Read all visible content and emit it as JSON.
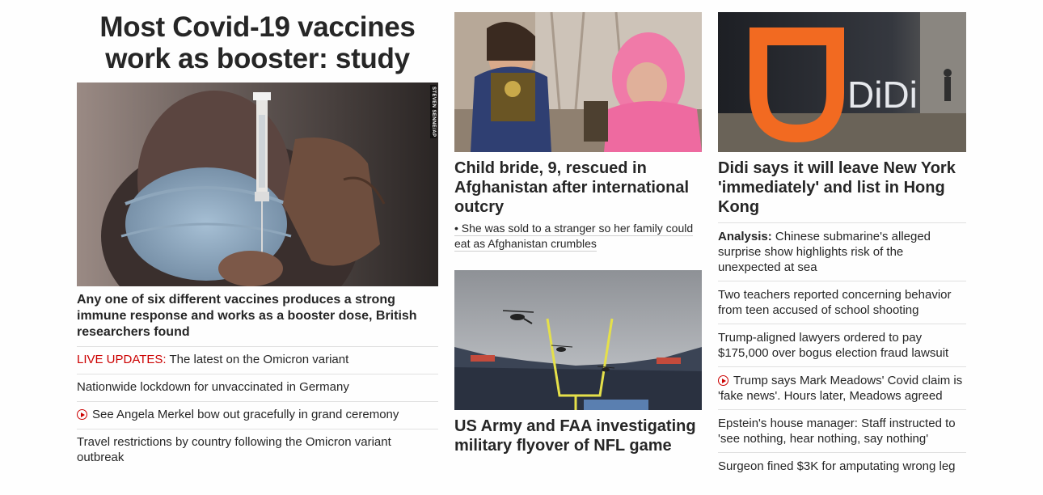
{
  "col1": {
    "headline": "Most Covid-19 vaccines work as booster: study",
    "photo_credit": "STEVEN SENNE/AP",
    "description": "Any one of six different vaccines produces a strong immune response and works as a booster dose, British researchers found",
    "links": [
      {
        "prefix": "LIVE UPDATES:",
        "text": " The latest on the Omicron variant"
      },
      {
        "text": "Nationwide lockdown for unvaccinated in Germany"
      },
      {
        "text": "See Angela Merkel bow out gracefully in grand ceremony",
        "icon": "play-icon"
      },
      {
        "text": "Travel restrictions by country following the Omicron variant outbreak"
      }
    ]
  },
  "col2": {
    "story1": {
      "title": "Child bride, 9, rescued in Afghanistan after international outcry",
      "bullet": "• She was sold to a stranger so her family could eat as Afghanistan crumbles"
    },
    "story2": {
      "title": "US Army and FAA investigating military flyover of NFL game"
    }
  },
  "col3": {
    "story": {
      "title": "Didi says it will leave New York 'immediately' and list in Hong Kong",
      "logo_text": "DiDi"
    },
    "links": [
      {
        "prefix": "Analysis:",
        "text": " Chinese submarine's alleged surprise show highlights risk of the unexpected at sea"
      },
      {
        "text": "Two teachers reported concerning behavior from teen accused of school shooting"
      },
      {
        "text": "Trump-aligned lawyers ordered to pay $175,000 over bogus election fraud lawsuit"
      },
      {
        "text": "Trump says Mark Meadows' Covid claim is 'fake news'. Hours later, Meadows agreed",
        "icon": "play-icon"
      },
      {
        "text": "Epstein's house manager: Staff instructed to 'see nothing, hear nothing, say nothing'"
      },
      {
        "text": "Surgeon fined $3K for amputating wrong leg"
      }
    ]
  },
  "colors": {
    "live_red": "#cc0000",
    "text": "#262626",
    "divider": "#e0e0e0",
    "didi_orange": "#f26a21"
  }
}
